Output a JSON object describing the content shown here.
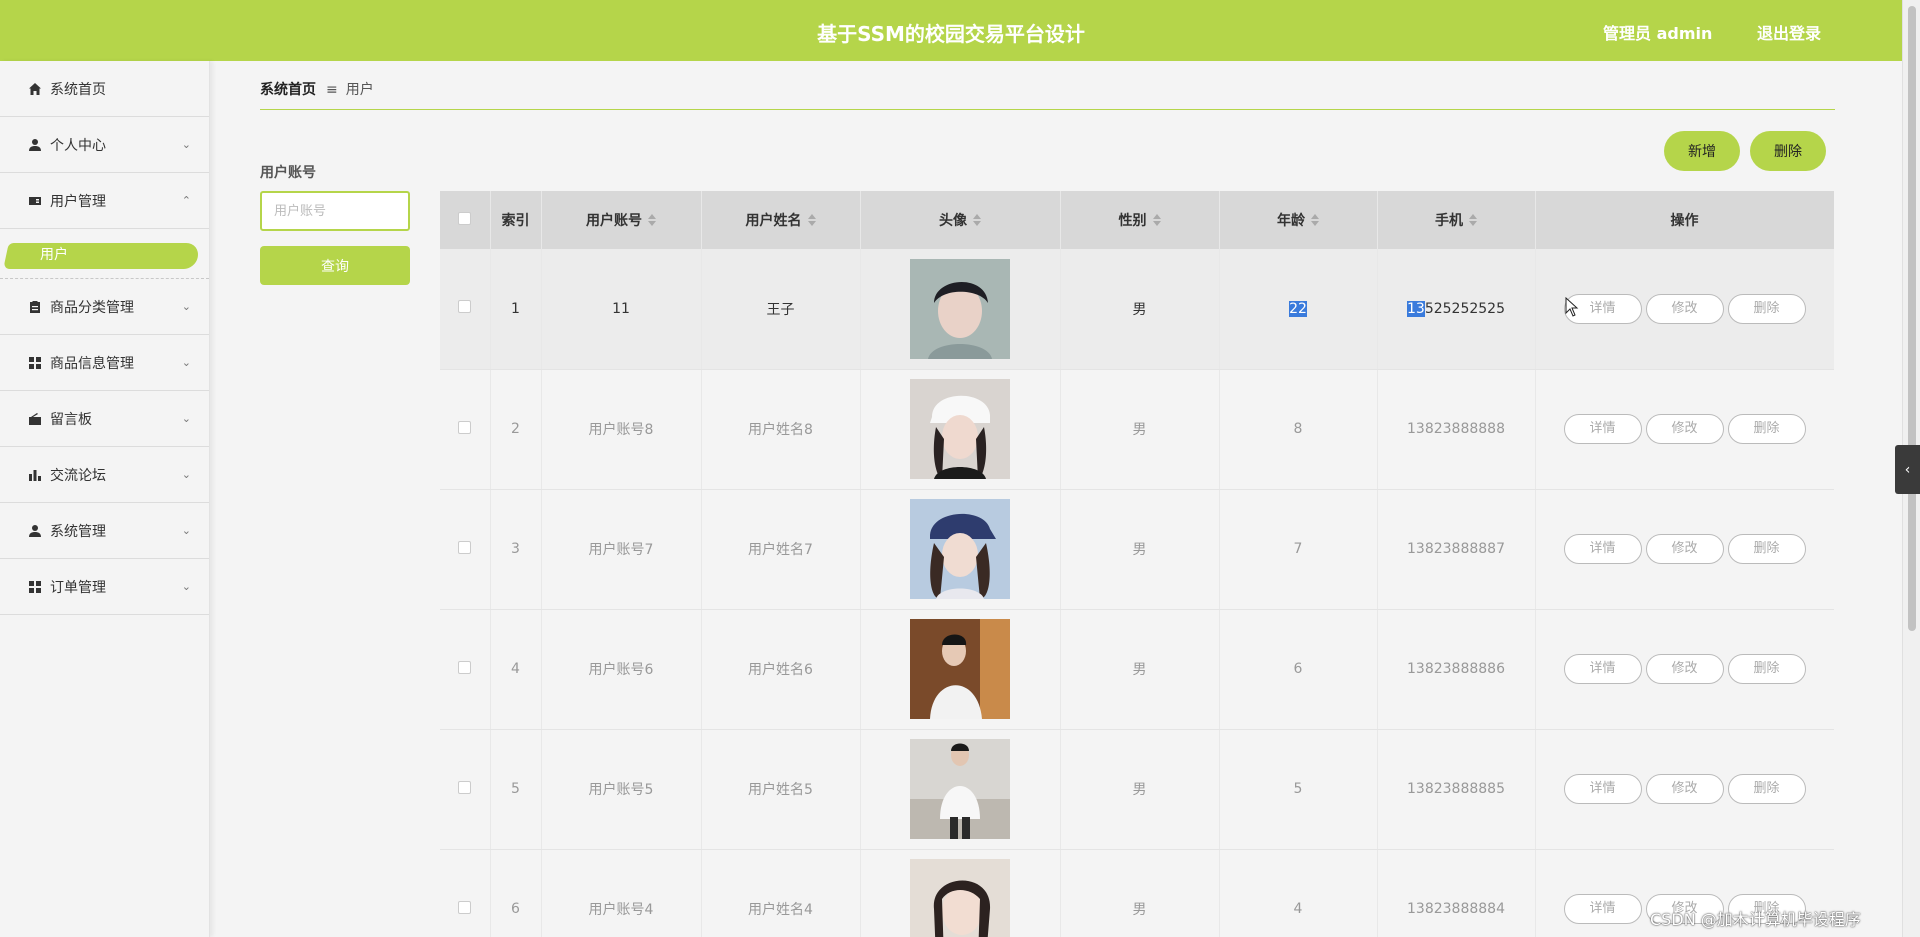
{
  "header": {
    "title": "基于SSM的校园交易平台设计",
    "user": "管理员 admin",
    "logout": "退出登录"
  },
  "sidebar": {
    "items": [
      {
        "label": "系统首页",
        "icon": "home-icon"
      },
      {
        "label": "个人中心",
        "icon": "user-icon",
        "chevron": "down"
      },
      {
        "label": "用户管理",
        "icon": "id-card-icon",
        "chevron": "up"
      },
      {
        "label": "商品分类管理",
        "icon": "clipboard-icon",
        "chevron": "down"
      },
      {
        "label": "商品信息管理",
        "icon": "grid-icon",
        "chevron": "down"
      },
      {
        "label": "留言板",
        "icon": "message-board-icon",
        "chevron": "down"
      },
      {
        "label": "交流论坛",
        "icon": "bar-chart-icon",
        "chevron": "down"
      },
      {
        "label": "系统管理",
        "icon": "user-icon",
        "chevron": "down"
      },
      {
        "label": "订单管理",
        "icon": "grid-icon",
        "chevron": "down"
      }
    ],
    "submenu_active": "用户"
  },
  "breadcrumb": {
    "home": "系统首页",
    "current": "用户"
  },
  "search": {
    "label": "用户账号",
    "placeholder": "用户账号",
    "button": "查询"
  },
  "toolbar": {
    "add": "新增",
    "delete": "删除"
  },
  "table": {
    "columns": [
      "索引",
      "用户账号",
      "用户姓名",
      "头像",
      "性别",
      "年龄",
      "手机",
      "操作"
    ],
    "ops": [
      "详情",
      "修改",
      "删除"
    ],
    "rows": [
      {
        "index": "1",
        "account": "11",
        "name": "王子",
        "gender": "男",
        "age": "22",
        "phone_a": "13",
        "phone_b": "525252525"
      },
      {
        "index": "2",
        "account": "用户账号8",
        "name": "用户姓名8",
        "gender": "男",
        "age": "8",
        "phone": "13823888888"
      },
      {
        "index": "3",
        "account": "用户账号7",
        "name": "用户姓名7",
        "gender": "男",
        "age": "7",
        "phone": "13823888887"
      },
      {
        "index": "4",
        "account": "用户账号6",
        "name": "用户姓名6",
        "gender": "男",
        "age": "6",
        "phone": "13823888886"
      },
      {
        "index": "5",
        "account": "用户账号5",
        "name": "用户姓名5",
        "gender": "男",
        "age": "5",
        "phone": "13823888885"
      },
      {
        "index": "6",
        "account": "用户账号4",
        "name": "用户姓名4",
        "gender": "男",
        "age": "4",
        "phone": "13823888884"
      }
    ]
  },
  "watermark": "CSDN @加木计算机毕设程序"
}
